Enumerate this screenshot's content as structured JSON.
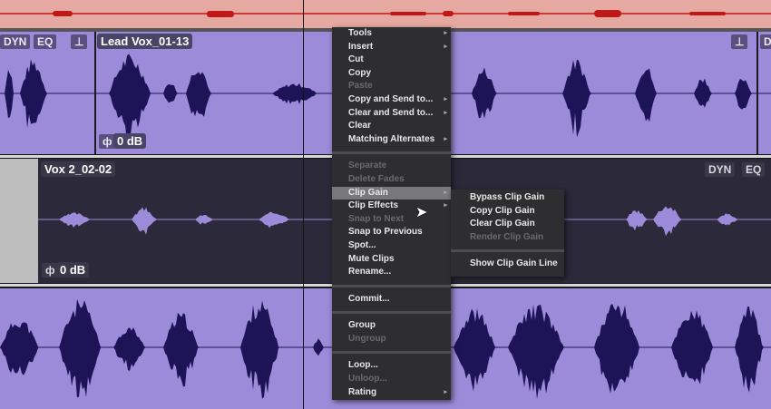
{
  "track1": {
    "clip_label": "Lead Vox_01-13",
    "gain": "0 dB",
    "badges": [
      "DYN",
      "EQ"
    ],
    "right_badge": "DYN"
  },
  "track2": {
    "clip_label": "Vox 2_02-02",
    "gain": "0 dB",
    "badges": [
      "DYN",
      "EQ"
    ]
  },
  "context_menu": [
    {
      "type": "item",
      "label": "Tools",
      "submenu": true
    },
    {
      "type": "item",
      "label": "Insert",
      "submenu": true
    },
    {
      "type": "item",
      "label": "Cut"
    },
    {
      "type": "item",
      "label": "Copy"
    },
    {
      "type": "item",
      "label": "Paste",
      "disabled": true
    },
    {
      "type": "item",
      "label": "Copy and Send to...",
      "submenu": true
    },
    {
      "type": "item",
      "label": "Clear and Send to...",
      "submenu": true
    },
    {
      "type": "item",
      "label": "Clear"
    },
    {
      "type": "item",
      "label": "Matching Alternates",
      "submenu": true
    },
    {
      "type": "separator"
    },
    {
      "type": "item",
      "label": "Separate",
      "disabled": true
    },
    {
      "type": "item",
      "label": "Delete Fades",
      "disabled": true
    },
    {
      "type": "item",
      "label": "Clip Gain",
      "submenu": true,
      "highlighted": true
    },
    {
      "type": "item",
      "label": "Clip Effects",
      "submenu": true
    },
    {
      "type": "item",
      "label": "Snap to Next",
      "disabled": true
    },
    {
      "type": "item",
      "label": "Snap to Previous"
    },
    {
      "type": "item",
      "label": "Spot..."
    },
    {
      "type": "item",
      "label": "Mute Clips"
    },
    {
      "type": "item",
      "label": "Rename..."
    },
    {
      "type": "separator"
    },
    {
      "type": "item",
      "label": "Commit..."
    },
    {
      "type": "separator"
    },
    {
      "type": "item",
      "label": "Group"
    },
    {
      "type": "item",
      "label": "Ungroup",
      "disabled": true
    },
    {
      "type": "separator"
    },
    {
      "type": "item",
      "label": "Loop..."
    },
    {
      "type": "item",
      "label": "Unloop...",
      "disabled": true
    },
    {
      "type": "item",
      "label": "Rating",
      "submenu": true
    }
  ],
  "clip_gain_submenu": [
    {
      "type": "item",
      "label": "Bypass Clip Gain"
    },
    {
      "type": "item",
      "label": "Copy Clip Gain"
    },
    {
      "type": "item",
      "label": "Clear Clip Gain"
    },
    {
      "type": "item",
      "label": "Render Clip Gain",
      "disabled": true
    },
    {
      "type": "separator"
    },
    {
      "type": "item",
      "label": "Show Clip Gain Line"
    }
  ],
  "colors": {
    "clip": "#9c8bd8",
    "waveform": "#1c1457",
    "selected_track": "#2c2a3a",
    "selected_wave": "#9c8bd8",
    "automation": "#e6a9a1",
    "automation_line": "#c01818"
  }
}
